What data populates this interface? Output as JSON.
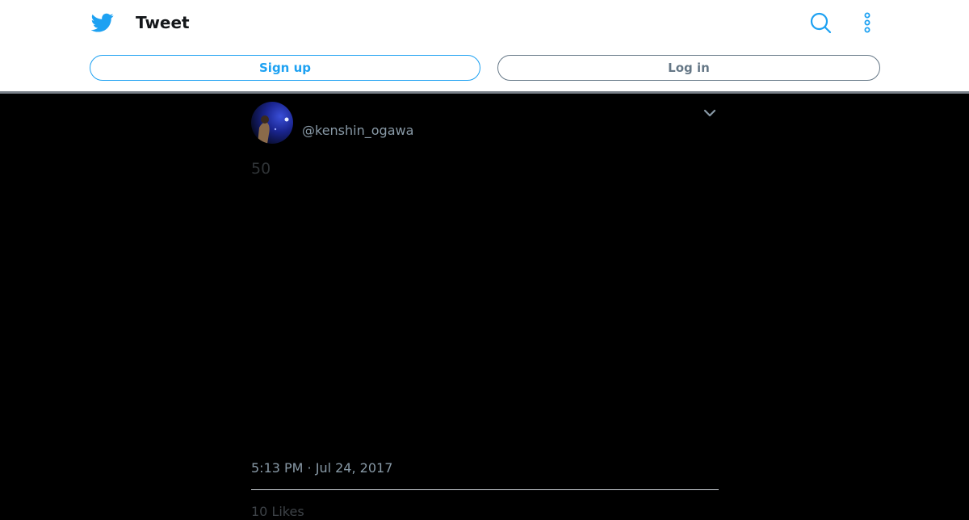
{
  "header": {
    "logo_icon": "twitter-bird-icon",
    "title": "Tweet",
    "search_icon": "search-icon",
    "more_icon": "more-vertical-icon",
    "brand_color": "#1da1f2"
  },
  "actions": {
    "signup_label": "Sign up",
    "login_label": "Log in"
  },
  "tweet": {
    "handle": "@kenshin_ogawa",
    "text": "50",
    "timestamp": "5:13 PM · Jul 24, 2017",
    "caret_icon": "chevron-down-icon",
    "likes_partial": "10 Likes"
  }
}
